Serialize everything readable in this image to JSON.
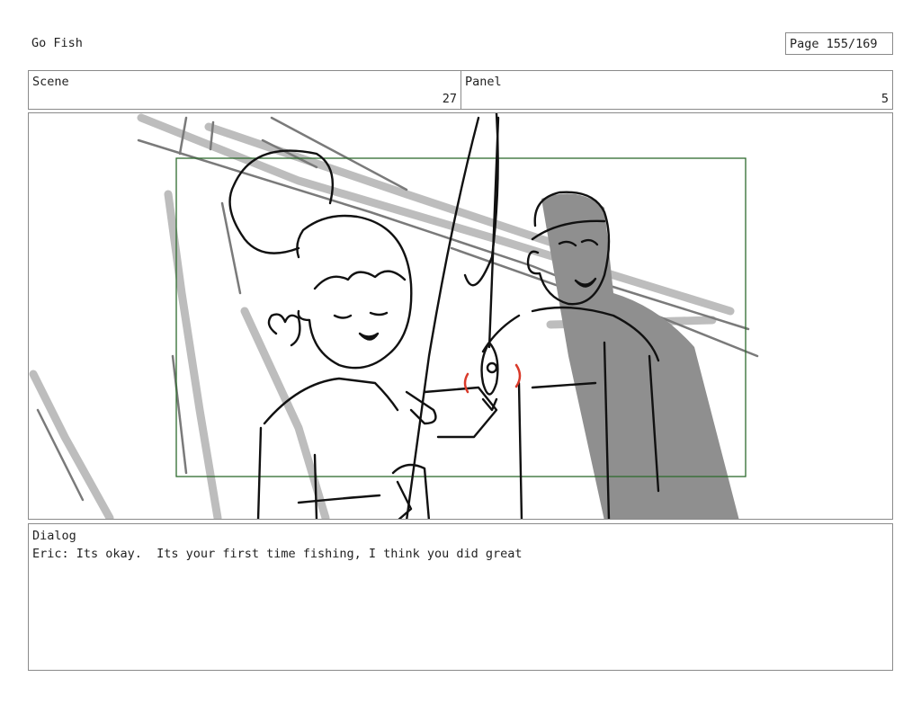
{
  "header": {
    "project_title": "Go Fish",
    "page_indicator": "Page 155/169"
  },
  "scene": {
    "label": "Scene",
    "value": "27"
  },
  "panel": {
    "label": "Panel",
    "value": "5"
  },
  "frame": {
    "guide_color": "#2e6b2e",
    "shadow_color": "#8f8f8f",
    "accent_color": "#d93a2a"
  },
  "dialog": {
    "label": "Dialog",
    "text": "Eric: Its okay.  Its your first time fishing, I think you did great"
  }
}
